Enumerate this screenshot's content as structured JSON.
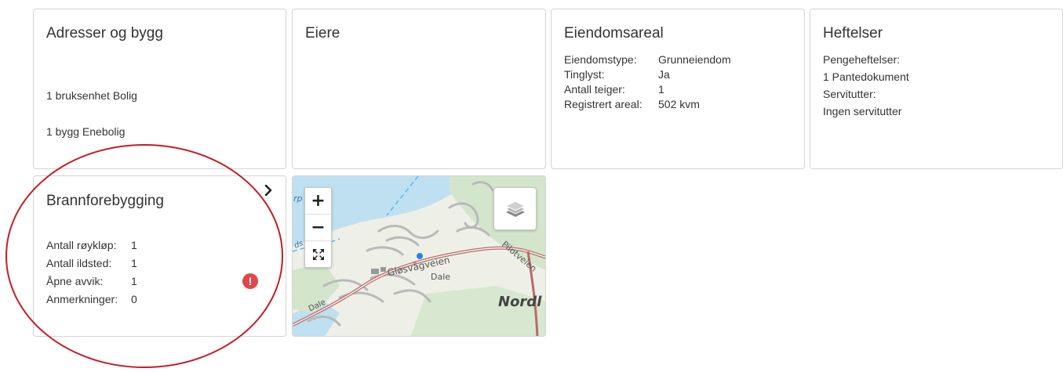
{
  "cards": {
    "adresser": {
      "title": "Adresser og bygg",
      "lines": [
        "1 bruksenhet Bolig",
        "1 bygg Enebolig"
      ]
    },
    "eiere": {
      "title": "Eiere"
    },
    "areal": {
      "title": "Eiendomsareal",
      "rows": [
        {
          "label": "Eiendomstype:",
          "value": "Grunneiendom"
        },
        {
          "label": "Tinglyst:",
          "value": "Ja"
        },
        {
          "label": "Antall teiger:",
          "value": "1"
        },
        {
          "label": "Registrert areal:",
          "value": "502 kvm"
        }
      ]
    },
    "heftelser": {
      "title": "Heftelser",
      "lines": [
        "Pengeheftelser:",
        "1 Pantedokument",
        "Servitutter:",
        "Ingen servitutter"
      ]
    },
    "brann": {
      "title": "Brannforebygging",
      "rows": [
        {
          "label": "Antall røykløp:",
          "value": "1"
        },
        {
          "label": "Antall ildsted:",
          "value": "1"
        },
        {
          "label": "Åpne avvik:",
          "value": "1"
        },
        {
          "label": "Anmerkninger:",
          "value": "0"
        }
      ],
      "alert_icon": "exclamation-icon",
      "alert_color": "#e04848",
      "chevron_icon": "chevron-right-icon"
    }
  },
  "map": {
    "zoom_in": "+",
    "zoom_out": "−",
    "labels": {
      "road1": "Gløsvågveien",
      "road2": "Pilotveien",
      "place1": "Dale",
      "place2": "Dale",
      "region": "Nordl",
      "corner": "rp",
      "side": "ds"
    },
    "colors": {
      "water": "#bfe0f0",
      "land": "#eef0e8",
      "forest": "#d3e6cc",
      "road": "#b86a6a",
      "marker": "#2f7fe8"
    }
  },
  "annotation": {
    "color": "#c41c24"
  }
}
